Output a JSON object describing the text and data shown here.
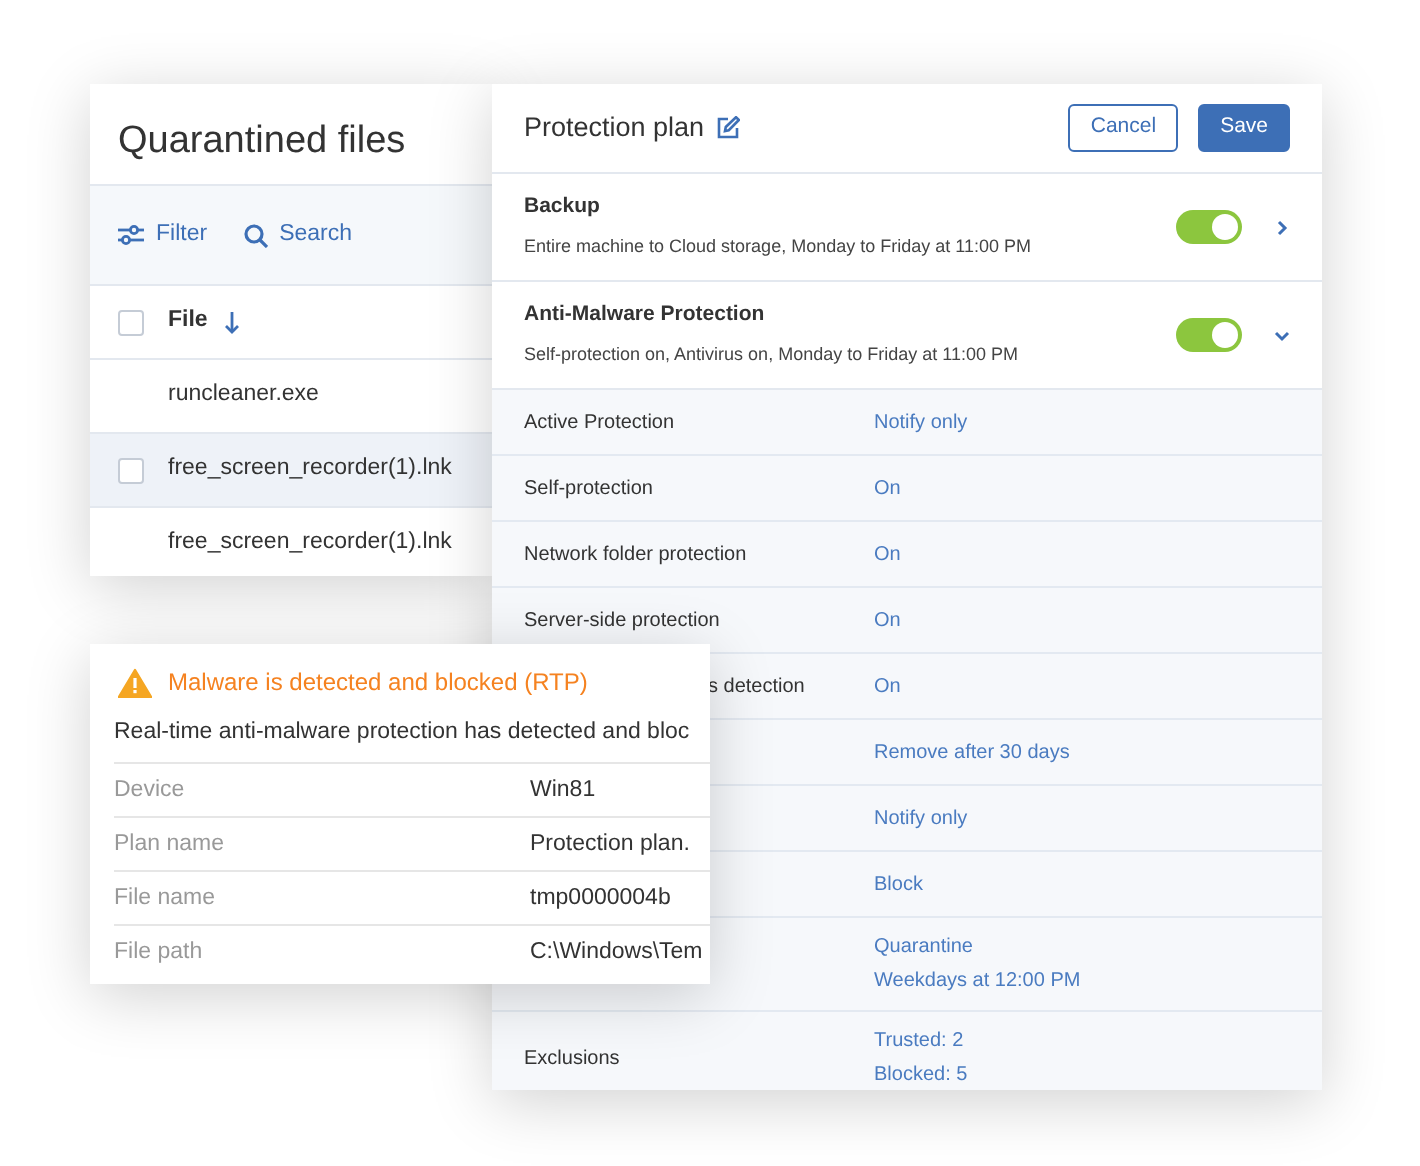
{
  "quarantine": {
    "title": "Quarantined files",
    "toolbar": [
      {
        "kind": "filter",
        "label": "Filter"
      },
      {
        "kind": "search",
        "label": "Search"
      }
    ],
    "header": {
      "label": "File",
      "checked": false
    },
    "rows": [
      {
        "name": "runcleaner.exe",
        "selected": false
      },
      {
        "name": "free_screen_recorder(1).lnk",
        "selected": true
      },
      {
        "name": "free_screen_recorder(1).lnk",
        "selected": false
      }
    ]
  },
  "plan": {
    "title": "Protection plan",
    "buttons": [
      {
        "kind": "outline",
        "label": "Cancel"
      },
      {
        "kind": "primary",
        "label": "Save"
      }
    ],
    "sections": [
      {
        "title": "Backup",
        "description": "Entire machine to Cloud storage, Monday to Friday at 11:00 PM",
        "on": true,
        "expanded": false
      },
      {
        "title": "Anti-Malware Protection",
        "description": "Self-protection on, Antivirus on, Monday to Friday at 11:00 PM",
        "on": true,
        "expanded": true
      }
    ],
    "settings": [
      {
        "label": "Active Protection",
        "values": [
          "Notify only"
        ]
      },
      {
        "label": "Self-protection",
        "values": [
          "On"
        ]
      },
      {
        "label": "Network folder protection",
        "values": [
          "On"
        ]
      },
      {
        "label": "Server-side protection",
        "values": [
          "On"
        ]
      },
      {
        "label": "s detection",
        "cut": true,
        "values": [
          "On"
        ]
      },
      {
        "values": [
          "Remove after 30 days"
        ]
      },
      {
        "values": [
          "Notify only"
        ]
      },
      {
        "values": [
          "Block"
        ]
      },
      {
        "values": [
          "Quarantine",
          "Weekdays at 12:00 PM"
        ]
      },
      {
        "label": "Exclusions",
        "values": [
          "Trusted: 2",
          "Blocked: 5"
        ]
      }
    ]
  },
  "alert": {
    "title": "Malware is detected and blocked (RTP)",
    "message": "Real-time anti-malware protection has detected and bloc",
    "details": [
      {
        "label": "Device",
        "value": "Win81"
      },
      {
        "label": "Plan name",
        "value": "Protection plan."
      },
      {
        "label": "File name",
        "value": "tmp0000004b"
      },
      {
        "label": "File path",
        "value": "C:\\Windows\\Tem"
      }
    ]
  }
}
